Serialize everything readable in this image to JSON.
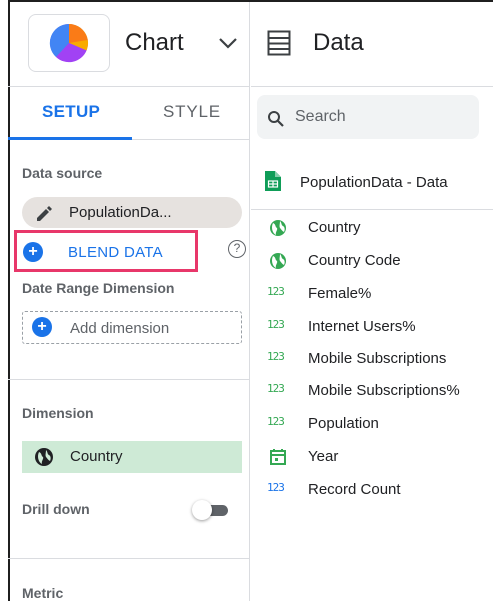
{
  "left_panel": {
    "chart_title": "Chart",
    "tabs": [
      {
        "label": "SETUP"
      },
      {
        "label": "STYLE"
      }
    ],
    "data_source": {
      "label": "Data source",
      "value": "PopulationDa...",
      "blend_label": "BLEND DATA",
      "help_glyph": "?"
    },
    "date_range": {
      "label": "Date Range Dimension",
      "add_label": "Add dimension"
    },
    "dimension": {
      "label": "Dimension",
      "value": "Country"
    },
    "drill_down": {
      "label": "Drill down",
      "enabled": false
    },
    "metric": {
      "label": "Metric"
    }
  },
  "right_panel": {
    "title": "Data",
    "search_placeholder": "Search",
    "data_source_name": "PopulationData - Data",
    "number_glyph": "123",
    "fields": [
      {
        "name": "Country",
        "type": "geo"
      },
      {
        "name": "Country Code",
        "type": "geo"
      },
      {
        "name": "Female%",
        "type": "number"
      },
      {
        "name": "Internet Users%",
        "type": "number"
      },
      {
        "name": "Mobile Subscriptions",
        "type": "number"
      },
      {
        "name": "Mobile Subscriptions%",
        "type": "number"
      },
      {
        "name": "Population",
        "type": "number"
      },
      {
        "name": "Year",
        "type": "date"
      },
      {
        "name": "Record Count",
        "type": "number-metric"
      }
    ]
  },
  "colors": {
    "accent": "#1a73e8",
    "highlight_border": "#e8376a",
    "dimension_chip": "#ceead6",
    "datasource_chip": "#e6e2df",
    "field_green": "#34a853"
  }
}
